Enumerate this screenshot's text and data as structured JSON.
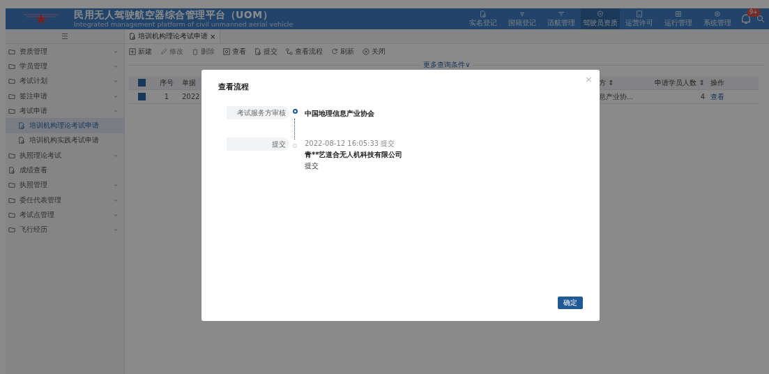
{
  "header": {
    "title": "民用无人驾驶航空器综合管理平台（UOM）",
    "subtitle": "Integrated management platform of civil unmanned aerial vehicle",
    "nav": [
      {
        "label": "实名登记",
        "selected": false
      },
      {
        "label": "国籍登记",
        "selected": false
      },
      {
        "label": "适航管理",
        "selected": false
      },
      {
        "label": "驾驶员资质",
        "selected": true
      },
      {
        "label": "运营许可",
        "selected": false
      },
      {
        "label": "运行管理",
        "selected": false
      },
      {
        "label": "系统管理",
        "selected": false
      }
    ],
    "badge": "9+"
  },
  "sidebar": {
    "menu_icon": "☰",
    "items": [
      {
        "label": "资质管理",
        "kind": "folder",
        "expanded": false
      },
      {
        "label": "学员管理",
        "kind": "folder",
        "expanded": false
      },
      {
        "label": "考试计划",
        "kind": "folder",
        "expanded": false
      },
      {
        "label": "签注申请",
        "kind": "folder",
        "expanded": false
      },
      {
        "label": "考试申请",
        "kind": "folder",
        "expanded": true,
        "children": [
          {
            "label": "培训机构理论考试申请",
            "selected": true
          },
          {
            "label": "培训机构实践考试申请",
            "selected": false
          }
        ]
      },
      {
        "label": "执照理论考试",
        "kind": "folder",
        "expanded": false
      },
      {
        "label": "成绩查看",
        "kind": "page"
      },
      {
        "label": "执照管理",
        "kind": "folder",
        "expanded": false
      },
      {
        "label": "委任代表管理",
        "kind": "folder",
        "expanded": false
      },
      {
        "label": "考试点管理",
        "kind": "folder",
        "expanded": false
      },
      {
        "label": "飞行经历",
        "kind": "folder",
        "expanded": false
      }
    ]
  },
  "tabs": [
    {
      "label": "培训机构理论考试申请",
      "close": "×",
      "selected": true
    }
  ],
  "toolbar": [
    {
      "label": "新建",
      "disabled": false
    },
    {
      "label": "修改",
      "disabled": true
    },
    {
      "label": "删除",
      "disabled": true
    },
    {
      "label": "查看",
      "disabled": false
    },
    {
      "label": "提交",
      "disabled": false
    },
    {
      "label": "查看流程",
      "disabled": false
    },
    {
      "label": "刷新",
      "disabled": false
    },
    {
      "label": "关闭",
      "disabled": false
    }
  ],
  "more_filters": "更多查询条件∨",
  "table": {
    "columns": [
      "序号",
      "单据",
      "方 ⇕",
      "申请学员人数 ⇕",
      "操作"
    ],
    "rows": [
      {
        "checked": true,
        "cells": [
          "1",
          "2022",
          "息产业协...",
          "4"
        ],
        "action": "查看"
      }
    ],
    "all_checked": true
  },
  "dialog": {
    "title": "查看流程",
    "close": "×",
    "steps": [
      {
        "label": "考试服务方审核",
        "current": true,
        "org": "中国地理信息产业协会"
      },
      {
        "label": "提交",
        "current": false,
        "time": "2022-08-12 16:05:33 提交",
        "org": "青**艺道合无人机科技有限公司",
        "note": "提交"
      }
    ],
    "ok": "确定"
  }
}
